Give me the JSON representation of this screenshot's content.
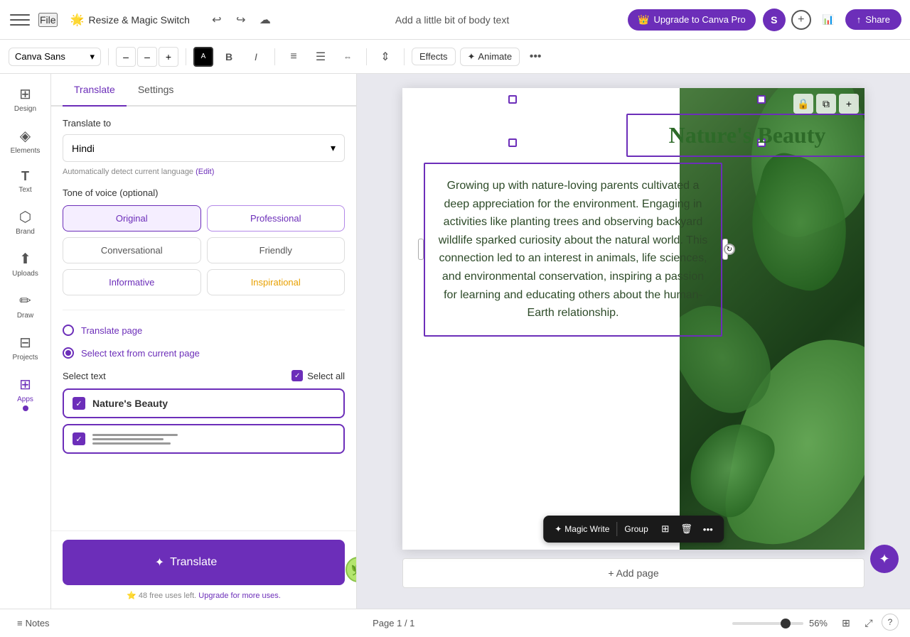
{
  "topbar": {
    "menu_label": "≡",
    "file_label": "File",
    "resize_magic_label": "Resize & Magic Switch",
    "emoji": "🌟",
    "undo_label": "↩",
    "redo_label": "↪",
    "save_icon": "☁",
    "title": "Add a little bit of body text",
    "upgrade_label": "Upgrade to Canva Pro",
    "upgrade_icon": "👑",
    "avatar_label": "S",
    "share_label": "Share",
    "share_icon": "↑"
  },
  "toolbar": {
    "font_name": "Canva Sans",
    "font_size_decrease": "–",
    "font_size_value": "–",
    "font_size_increase": "+",
    "bold_label": "B",
    "italic_label": "I",
    "align_left": "≡",
    "align_center": "☰",
    "align_right": "≡",
    "line_height": "⇕",
    "effects_label": "Effects",
    "animate_label": "Animate",
    "more_label": "•••"
  },
  "sidebar": {
    "items": [
      {
        "id": "design",
        "icon": "⊞",
        "label": "Design"
      },
      {
        "id": "elements",
        "icon": "◈",
        "label": "Elements"
      },
      {
        "id": "text",
        "icon": "T",
        "label": "Text"
      },
      {
        "id": "brand",
        "icon": "⬡",
        "label": "Brand"
      },
      {
        "id": "uploads",
        "icon": "⬆",
        "label": "Uploads"
      },
      {
        "id": "draw",
        "icon": "✏",
        "label": "Draw"
      },
      {
        "id": "projects",
        "icon": "⊟",
        "label": "Projects"
      },
      {
        "id": "apps",
        "icon": "⊞",
        "label": "Apps"
      }
    ]
  },
  "panel": {
    "tab_translate": "Translate",
    "tab_settings": "Settings",
    "translate_to_label": "Translate to",
    "language": "Hindi",
    "auto_detect_text": "Automatically detect current language",
    "edit_link": "(Edit)",
    "tone_label": "Tone of voice (optional)",
    "tones": [
      {
        "id": "original",
        "label": "Original",
        "active": true
      },
      {
        "id": "professional",
        "label": "Professional",
        "active": false
      },
      {
        "id": "conversational",
        "label": "Conversational",
        "active": false
      },
      {
        "id": "friendly",
        "label": "Friendly",
        "active": false
      },
      {
        "id": "informative",
        "label": "Informative",
        "active": false
      },
      {
        "id": "inspirational",
        "label": "Inspirational",
        "active": false
      }
    ],
    "translate_page_label": "Translate page",
    "select_text_label": "Select text from current page",
    "select_text_header": "Select text",
    "select_all_label": "Select all",
    "text_items": [
      {
        "id": "title",
        "label": "Nature's Beauty",
        "type": "title"
      },
      {
        "id": "body",
        "label": "",
        "type": "body"
      }
    ],
    "translate_btn_label": "Translate",
    "translate_sparkle": "✦",
    "free_uses_text": "48 free uses left.",
    "upgrade_link": "Upgrade for more uses."
  },
  "canvas": {
    "title_text": "Nature's Beauty",
    "body_text": "Growing up with nature-loving parents cultivated a deep appreciation for the environment. Engaging in activities like planting trees and observing backyard wildlife sparked curiosity about the natural world. This connection led to an interest in animals, life sciences, and environmental conservation, inspiring a passion for learning and educating others about the human-Earth relationship.",
    "lock_icon": "🔒",
    "copy_icon": "⧉",
    "plus_icon": "+",
    "floating_toolbar": {
      "magic_write_label": "Magic Write",
      "magic_icon": "✦",
      "group_label": "Group",
      "copy_icon": "⊞",
      "delete_icon": "🗑",
      "more_icon": "•••"
    },
    "add_page_label": "+ Add page"
  },
  "bottombar": {
    "notes_icon": "≡",
    "notes_label": "Notes",
    "page_indicator": "Page 1 / 1",
    "zoom_level": "56%",
    "grid_icon": "⊞",
    "fullscreen_icon": "⤢",
    "help_icon": "?"
  },
  "colors": {
    "purple": "#6c2eb9",
    "green_text": "#2d6a28",
    "canvas_bg": "#e8e8ee"
  }
}
